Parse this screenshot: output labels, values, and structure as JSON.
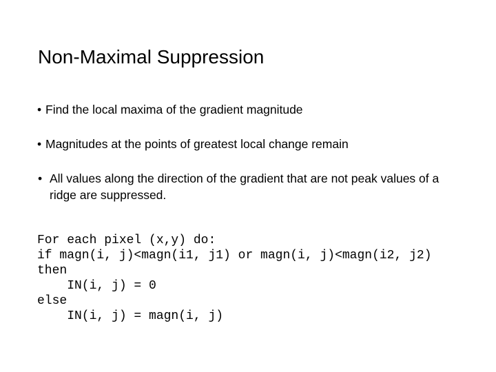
{
  "slide": {
    "title": "Non-Maximal Suppression",
    "background_color": "#ffffff",
    "text_color": "#000000"
  },
  "body": {
    "bullet_marker": "•",
    "bullets": [
      {
        "text": "Find the local maxima of the gradient magnitude"
      },
      {
        "text": "Magnitudes at the points of greatest local change remain"
      },
      {
        "text": " All values along the direction of the gradient that are not peak values of a ridge are suppressed."
      }
    ]
  },
  "code": {
    "lines": [
      "For each pixel (x,y) do:",
      "if magn(i, j)<magn(i1, j1) or magn(i, j)<magn(i2, j2)",
      "then",
      "    IN(i, j) = 0",
      "else",
      "    IN(i, j) = magn(i, j)"
    ]
  }
}
